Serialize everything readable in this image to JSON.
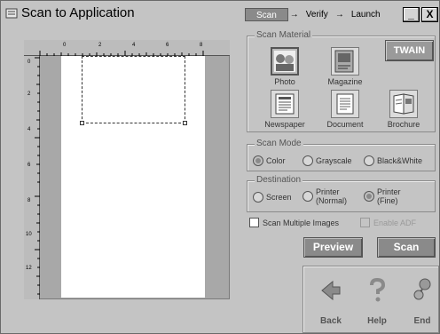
{
  "window": {
    "title": "Scan to Application"
  },
  "wizard": {
    "step1": "Scan",
    "step2": "Verify",
    "step3": "Launch",
    "arrow": "→"
  },
  "window_buttons": {
    "minimize": "_",
    "close": "X"
  },
  "ruler": {
    "top": [
      "0",
      "2",
      "4",
      "6",
      "8"
    ],
    "left": [
      "0",
      "2",
      "4",
      "6",
      "8",
      "10",
      "12"
    ]
  },
  "scan_material": {
    "legend": "Scan Material",
    "twain": "TWAIN",
    "items": [
      {
        "label": "Photo",
        "icon": "photo-icon",
        "selected": true
      },
      {
        "label": "Magazine",
        "icon": "magazine-icon",
        "selected": false
      },
      {
        "label": "Newspaper",
        "icon": "newspaper-icon",
        "selected": false
      },
      {
        "label": "Document",
        "icon": "document-icon",
        "selected": false
      },
      {
        "label": "Brochure",
        "icon": "brochure-icon",
        "selected": false
      }
    ]
  },
  "scan_mode": {
    "legend": "Scan Mode",
    "options": [
      {
        "label": "Color",
        "selected": true
      },
      {
        "label": "Grayscale",
        "selected": false
      },
      {
        "label": "Black&White",
        "selected": false
      }
    ]
  },
  "destination": {
    "legend": "Destination",
    "options": [
      {
        "label": "Screen",
        "selected": false
      },
      {
        "label": "Printer",
        "sub": "(Normal)",
        "selected": false
      },
      {
        "label": "Printer",
        "sub": "(Fine)",
        "selected": true
      }
    ]
  },
  "options": {
    "multiple": {
      "label": "Scan Multiple Images",
      "checked": false
    },
    "adf": {
      "label": "Enable ADF",
      "checked": false,
      "enabled": false
    }
  },
  "actions": {
    "preview": "Preview",
    "scan": "Scan"
  },
  "nav": {
    "back": "Back",
    "help": "Help",
    "end": "End"
  },
  "colors": {
    "background": "#c4c4c4",
    "button": "#8a8a8a",
    "active_step": "#8a8a8a"
  }
}
